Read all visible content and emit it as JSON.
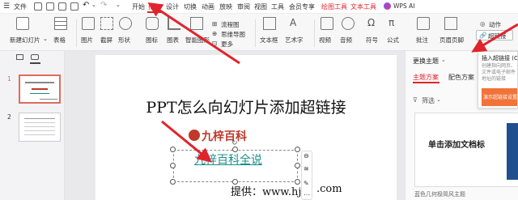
{
  "titlebar": {
    "menu_label": "文件",
    "tabs": [
      {
        "label": "开始",
        "color": "#222"
      },
      {
        "label": "插入",
        "color": "#e0242b"
      },
      {
        "label": "设计",
        "color": "#222"
      },
      {
        "label": "切换",
        "color": "#222"
      },
      {
        "label": "动画",
        "color": "#222"
      },
      {
        "label": "放映",
        "color": "#222"
      },
      {
        "label": "审阅",
        "color": "#222"
      },
      {
        "label": "视图",
        "color": "#222"
      },
      {
        "label": "工具",
        "color": "#222"
      },
      {
        "label": "会员专享",
        "color": "#222"
      },
      {
        "label": "绘图工具",
        "color": "#e0242b"
      },
      {
        "label": "文本工具",
        "color": "#e0242b"
      }
    ],
    "ai_label": "WPS AI",
    "undo_icon": "undo-icon",
    "redo_icon": "redo-icon"
  },
  "ribbon": {
    "new_slide": "新建幻灯片",
    "table": "表格",
    "picture": "图片",
    "screenshot": "截屏",
    "shape": "形状",
    "icon": "图标",
    "chart": "图表",
    "smart_graphic": "智能图形",
    "flowchart": "流程图",
    "mindmap": "思维导图",
    "more": "更多",
    "textbox": "文本框",
    "wordart": "艺术字",
    "video": "视频",
    "audio": "音频",
    "symbol": "符号",
    "formula": "公式",
    "comment": "批注",
    "header_footer": "页眉页脚",
    "action": "动作",
    "hyperlink": "超链接"
  },
  "left_pane": {
    "slide_numbers": [
      "1",
      "2"
    ]
  },
  "slide": {
    "title": "PPT怎么向幻灯片添加超链接",
    "logo_text": "九梓百科",
    "link_text": "九梓百科全说",
    "footer_text": "提供：www.hj",
    "footer_tail": ".com"
  },
  "right_pane": {
    "header": "更换主题",
    "tab_theme": "主题方案",
    "tab_color": "配色方案",
    "filter_label": "筛选",
    "preview_text": "单击添加文档标",
    "template_caption": "蓝色几何极简风主题"
  },
  "tooltip": {
    "title": "插入超链接 (Ctrl+K)",
    "desc": "创建指向网页、文件或电子邮件地址的链接",
    "thumb_label": "演示超链接设置"
  },
  "colors": {
    "accent": "#e0242b",
    "link": "#1a8f8a",
    "logo": "#c0392b"
  }
}
